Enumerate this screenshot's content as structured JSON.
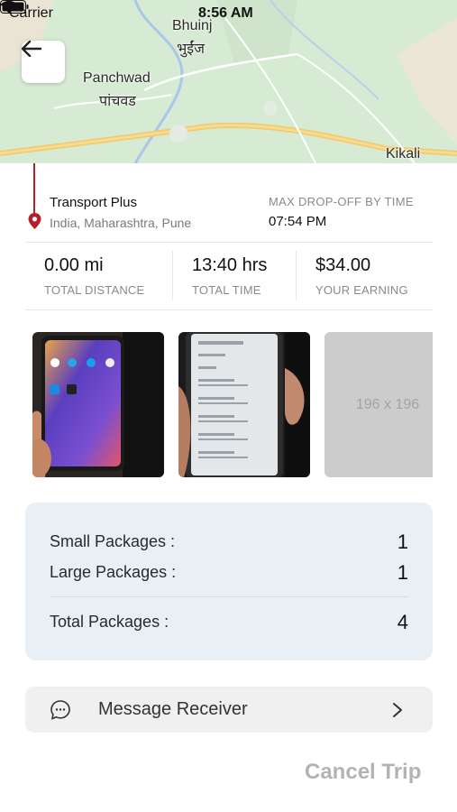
{
  "status_bar": {
    "carrier": "Carrier",
    "time": "8:56 AM"
  },
  "map": {
    "labels": [
      {
        "id": "bhuinj-en",
        "text": "Bhuinj"
      },
      {
        "id": "bhuinj-mr",
        "text": "भुईंज"
      },
      {
        "id": "panchwad-en",
        "text": "Panchwad"
      },
      {
        "id": "panchwad-mr",
        "text": "पांचवड"
      },
      {
        "id": "kikali",
        "text": "Kikali"
      }
    ]
  },
  "trip": {
    "pickup_name": "Transport Plus",
    "pickup_address": "India, Maharashtra, Pune",
    "drop_label": "MAX DROP-OFF BY TIME",
    "drop_time": "07:54 PM"
  },
  "stats": [
    {
      "value": "0.00 mi",
      "label": "TOTAL DISTANCE"
    },
    {
      "value": "13:40 hrs",
      "label": "TOTAL TIME"
    },
    {
      "value": "$34.00",
      "label": "YOUR EARNING"
    }
  ],
  "photos": {
    "placeholder_text": "196 x 196"
  },
  "packages": {
    "small_label": "Small Packages :",
    "small_count": "1",
    "large_label": "Large Packages :",
    "large_count": "1",
    "total_label": "Total Packages :",
    "total_count": "4"
  },
  "message_button": {
    "label": "Message Receiver",
    "icon": "chat-bubble-icon"
  },
  "cancel_button": {
    "label": "Cancel Trip"
  },
  "colors": {
    "route_red": "#b51f2a",
    "package_card_bg": "#e8f0f6",
    "muted_text": "#8a8a8a"
  }
}
